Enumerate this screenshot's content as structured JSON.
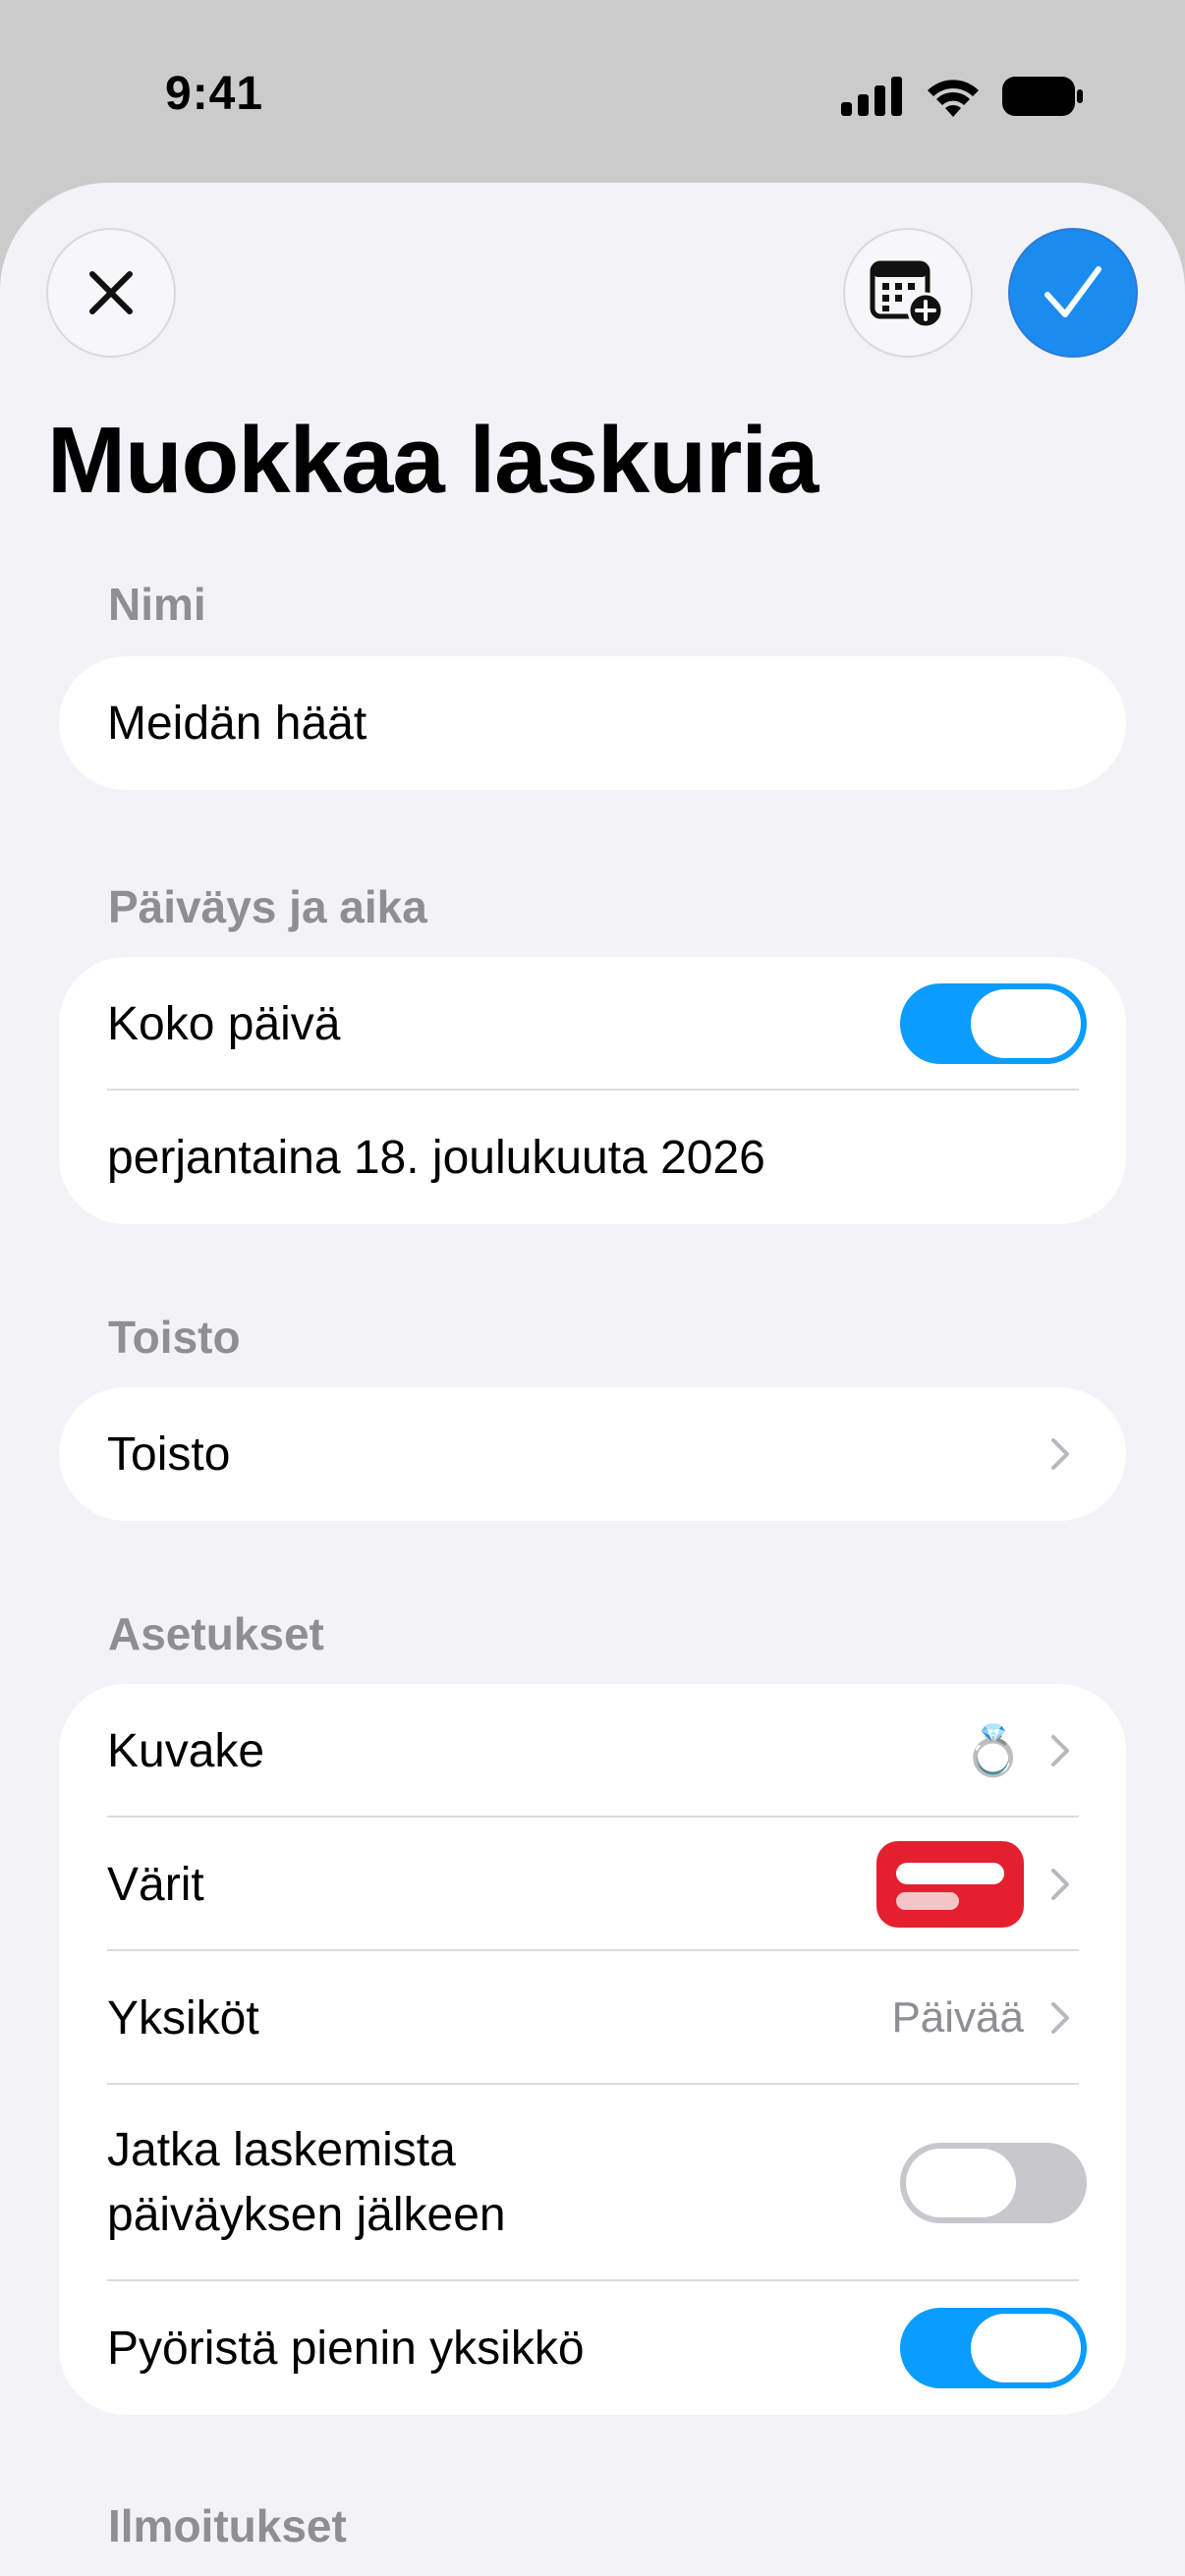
{
  "status_bar": {
    "time": "9:41",
    "icons": [
      "cellular-signal-icon",
      "wifi-icon",
      "battery-icon"
    ]
  },
  "toolbar": {
    "close_icon": "close-icon",
    "calendar_icon": "calendar-add-icon",
    "done_icon": "checkmark-icon"
  },
  "page": {
    "title": "Muokkaa laskuria"
  },
  "sections": {
    "name": {
      "header": "Nimi",
      "value": "Meidän häät"
    },
    "datetime": {
      "header": "Päiväys ja aika",
      "all_day_label": "Koko päivä",
      "all_day_on": true,
      "date_value": "perjantaina 18. joulukuuta 2026"
    },
    "repeat": {
      "header": "Toisto",
      "row_label": "Toisto"
    },
    "settings": {
      "header": "Asetukset",
      "icon_label": "Kuvake",
      "icon_value": "💍",
      "colors_label": "Värit",
      "colors_accent": "#e5202e",
      "units_label": "Yksiköt",
      "units_value": "Päivää",
      "continue_label_line1": "Jatka laskemista",
      "continue_label_line2": "päiväyksen jälkeen",
      "continue_on": false,
      "round_label": "Pyöristä pienin yksikkö",
      "round_on": true
    },
    "notifications": {
      "header": "Ilmoitukset"
    }
  },
  "colors": {
    "accent_blue": "#0a9cff",
    "done_button": "#1a8cf0",
    "background": "#f2f2f7",
    "secondary_text": "#8e8e93"
  }
}
